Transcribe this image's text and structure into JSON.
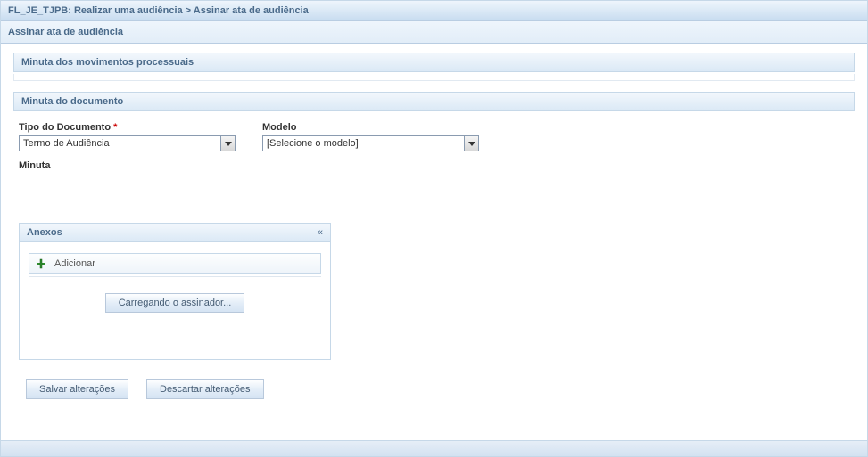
{
  "titlebar": "FL_JE_TJPB: Realizar uma audiência > Assinar ata de audiência",
  "subheader": "Assinar ata de audiência",
  "sections": {
    "movimentos": {
      "title": "Minuta dos movimentos processuais"
    },
    "documento": {
      "title": "Minuta do documento"
    }
  },
  "form": {
    "tipo": {
      "label": "Tipo do Documento",
      "required_marker": "*",
      "value": "Termo de Audiência"
    },
    "modelo": {
      "label": "Modelo",
      "placeholder": "[Selecione o modelo]"
    },
    "minuta_label": "Minuta"
  },
  "anexos": {
    "title": "Anexos",
    "collapse_glyph": "«",
    "add_label": "Adicionar",
    "signer_loading": "Carregando o assinador..."
  },
  "actions": {
    "save": "Salvar alterações",
    "discard": "Descartar alterações"
  }
}
